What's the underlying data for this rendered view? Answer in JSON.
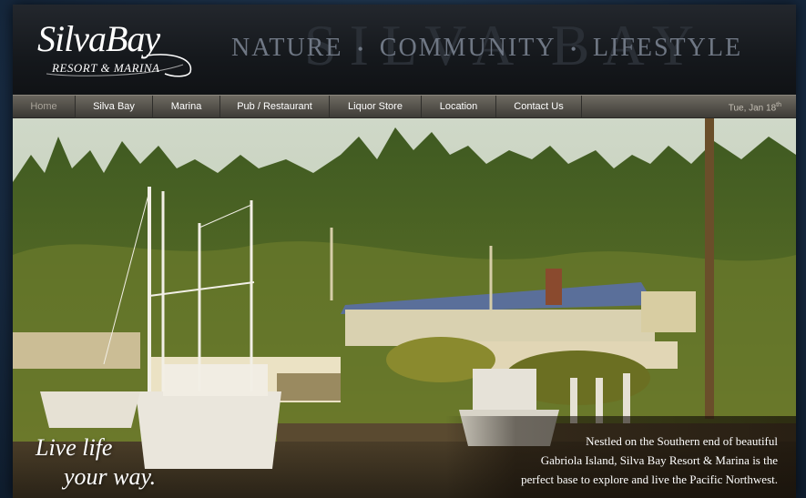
{
  "logo": {
    "name": "SilvaBay",
    "subtitle": "RESORT & MARINA"
  },
  "header": {
    "watermark": "SILVA BAY",
    "tagline": [
      "NATURE",
      "COMMUNITY",
      "LIFESTYLE"
    ],
    "separator": "•"
  },
  "nav": {
    "items": [
      "Home",
      "Silva Bay",
      "Marina",
      "Pub / Restaurant",
      "Liquor Store",
      "Location",
      "Contact Us"
    ],
    "active": "Home",
    "date": "Tue, Jan 18",
    "date_suffix": "th"
  },
  "hero": {
    "slogan_line1": "Live life",
    "slogan_line2": "your way.",
    "caption_lines": [
      "Nestled on the Southern end of beautiful",
      "Gabriola Island, Silva Bay Resort & Marina is the",
      "perfect base to explore and live the Pacific Northwest."
    ]
  },
  "colors": {
    "page_bg": "#1b3049",
    "header_bg": "#15181c",
    "nav_bg": "#56534c",
    "tagline": "#6f7784"
  }
}
